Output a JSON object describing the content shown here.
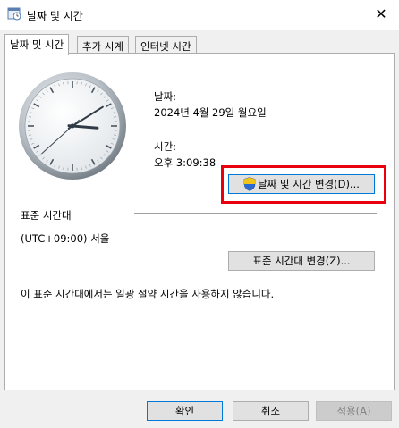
{
  "window": {
    "title": "날짜 및 시간",
    "close_glyph": "✕"
  },
  "tabs": [
    {
      "label": "날짜 및 시간",
      "active": true
    },
    {
      "label": "추가 시계",
      "active": false
    },
    {
      "label": "인터넷 시간",
      "active": false
    }
  ],
  "date_section": {
    "date_label": "날짜:",
    "date_value": "2024년 4월 29일 월요일",
    "time_label": "시간:",
    "time_value": "오후 3:09:38",
    "change_datetime_button": "날짜 및 시간 변경(D)..."
  },
  "clock": {
    "hour": 3,
    "minute": 9,
    "second": 38
  },
  "timezone_section": {
    "heading": "표준 시간대",
    "value": "(UTC+09:00) 서울",
    "change_timezone_button": "표준 시간대 변경(Z)...",
    "dst_note": "이 표준 시간대에서는 일광 절약 시간을 사용하지 않습니다."
  },
  "footer": {
    "ok_label": "확인",
    "cancel_label": "취소",
    "apply_label": "적용(A)"
  },
  "colors": {
    "highlight_box": "#e8000c",
    "dialog_background": "#f0f0f0",
    "panel_background": "#ffffff"
  },
  "icons": {
    "title": "clock-calendar-icon",
    "shield": "uac-shield-icon"
  }
}
